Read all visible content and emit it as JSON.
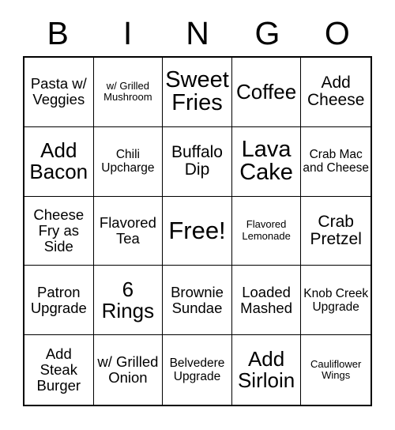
{
  "card": {
    "headers": [
      "B",
      "I",
      "N",
      "G",
      "O"
    ],
    "free_space_label": "Free!",
    "colors": {
      "background": "#ffffff",
      "text": "#000000",
      "gridline": "#000000",
      "outer_border": "#000000"
    },
    "rows": [
      [
        {
          "label": "Pasta w/ Veggies",
          "size": "m"
        },
        {
          "label": "w/ Grilled Mushroom",
          "size": "xs"
        },
        {
          "label": "Sweet Fries",
          "size": "xxl"
        },
        {
          "label": "Coffee",
          "size": "xl"
        },
        {
          "label": "Add Cheese",
          "size": "l"
        }
      ],
      [
        {
          "label": "Add Bacon",
          "size": "xl"
        },
        {
          "label": "Chili Upcharge",
          "size": "s"
        },
        {
          "label": "Buffalo Dip",
          "size": "l"
        },
        {
          "label": "Lava Cake",
          "size": "xxl"
        },
        {
          "label": "Crab Mac and Cheese",
          "size": "s"
        }
      ],
      [
        {
          "label": "Cheese Fry as Side",
          "size": "m"
        },
        {
          "label": "Flavored Tea",
          "size": "m"
        },
        {
          "label": "Free!",
          "size": "free"
        },
        {
          "label": "Flavored Lemonade",
          "size": "xs"
        },
        {
          "label": "Crab Pretzel",
          "size": "l"
        }
      ],
      [
        {
          "label": "Patron Upgrade",
          "size": "m"
        },
        {
          "label": "6 Rings",
          "size": "xl"
        },
        {
          "label": "Brownie Sundae",
          "size": "m"
        },
        {
          "label": "Loaded Mashed",
          "size": "m"
        },
        {
          "label": "Knob Creek Upgrade",
          "size": "s"
        }
      ],
      [
        {
          "label": "Add Steak Burger",
          "size": "m"
        },
        {
          "label": "w/ Grilled Onion",
          "size": "m"
        },
        {
          "label": "Belvedere Upgrade",
          "size": "s"
        },
        {
          "label": "Add Sirloin",
          "size": "xl"
        },
        {
          "label": "Cauliflower Wings",
          "size": "xs"
        }
      ]
    ]
  }
}
